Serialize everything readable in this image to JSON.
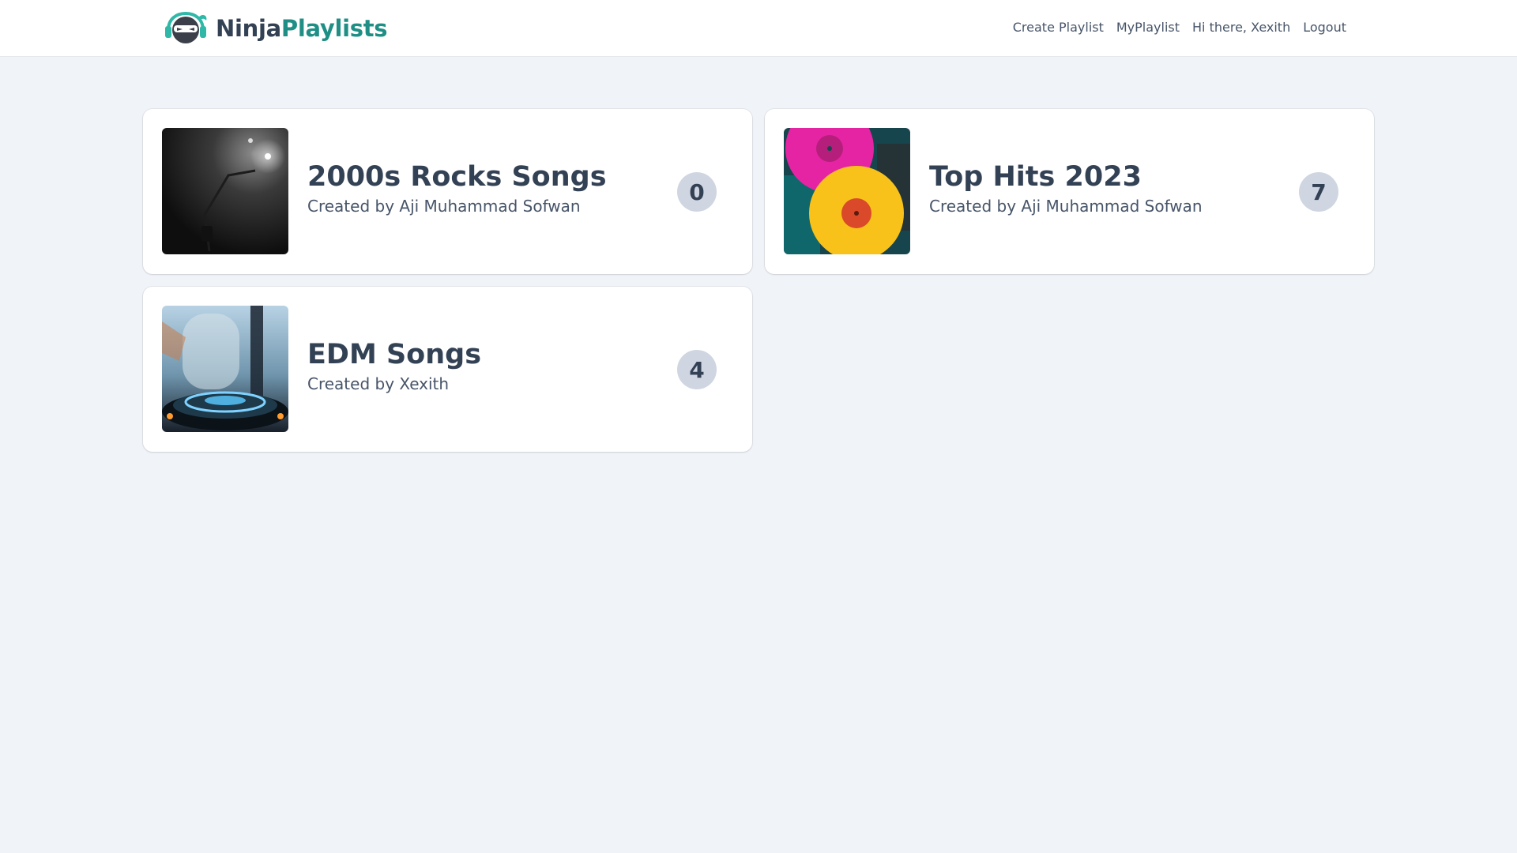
{
  "app": {
    "brand_part1": "Ninja",
    "brand_part2": "Playlists",
    "accent_color": "#1f8f86",
    "logo_icon": "ninja-headphones-logo"
  },
  "nav": {
    "create_playlist": "Create Playlist",
    "my_playlist": "MyPlaylist",
    "greeting": "Hi there, Xexith",
    "logout": "Logout"
  },
  "playlists": [
    {
      "title": "2000s Rocks Songs",
      "creator": "Created by Aji Muhammad Sofwan",
      "count": "0",
      "cover": "microphone-stage-image"
    },
    {
      "title": "Top Hits 2023",
      "creator": "Created by Aji Muhammad Sofwan",
      "count": "7",
      "cover": "vinyl-records-image"
    },
    {
      "title": "EDM Songs",
      "creator": "Created by Xexith",
      "count": "4",
      "cover": "dj-turntable-image"
    }
  ]
}
